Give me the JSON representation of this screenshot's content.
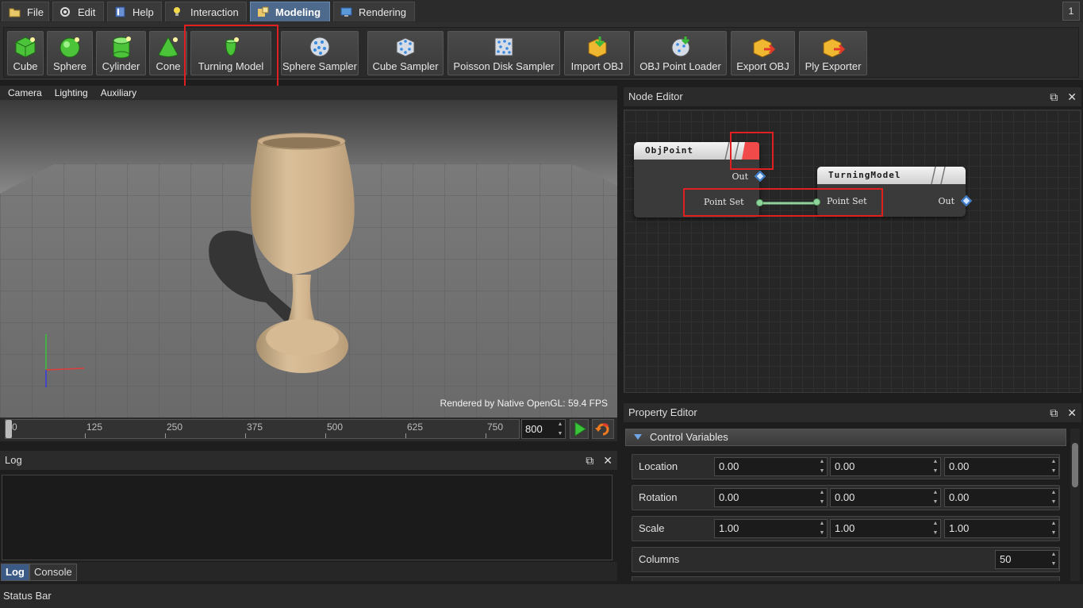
{
  "menu": {
    "tabs": [
      {
        "label": "File"
      },
      {
        "label": "Edit"
      },
      {
        "label": "Help"
      },
      {
        "label": "Interaction"
      },
      {
        "label": "Modeling"
      },
      {
        "label": "Rendering"
      }
    ],
    "corner_label": "1"
  },
  "toolbar": {
    "items": [
      {
        "label": "Cube"
      },
      {
        "label": "Sphere"
      },
      {
        "label": "Cylinder"
      },
      {
        "label": "Cone"
      },
      {
        "label": "Turning Model"
      },
      {
        "label": "Sphere Sampler"
      },
      {
        "label": "Cube Sampler"
      },
      {
        "label": "Poisson Disk Sampler"
      },
      {
        "label": "Import OBJ"
      },
      {
        "label": "OBJ Point Loader"
      },
      {
        "label": "Export OBJ"
      },
      {
        "label": "Ply Exporter"
      }
    ]
  },
  "viewport": {
    "menu": [
      "Camera",
      "Lighting",
      "Auxiliary"
    ],
    "fps_text": "Rendered by Native OpenGL: 59.4 FPS"
  },
  "timeline": {
    "ticks": [
      "0",
      "125",
      "250",
      "375",
      "500",
      "625",
      "750"
    ],
    "frame_value": "800"
  },
  "log": {
    "title": "Log",
    "tabs": [
      {
        "label": "Log"
      },
      {
        "label": "Console"
      }
    ]
  },
  "node_editor": {
    "title": "Node Editor",
    "nodes": [
      {
        "title": "ObjPoint",
        "out_label": "Out",
        "in_label": "Point Set"
      },
      {
        "title": "TurningModel",
        "out_label": "Out",
        "in_label": "Point Set"
      }
    ]
  },
  "property_editor": {
    "title": "Property Editor",
    "section": "Control Variables",
    "rows": [
      {
        "label": "Location",
        "values": [
          "0.00",
          "0.00",
          "0.00"
        ]
      },
      {
        "label": "Rotation",
        "values": [
          "0.00",
          "0.00",
          "0.00"
        ]
      },
      {
        "label": "Scale",
        "values": [
          "1.00",
          "1.00",
          "1.00"
        ]
      },
      {
        "label": "Columns",
        "values": [
          "50"
        ]
      }
    ]
  },
  "status_bar": "Status Bar",
  "colors": {
    "accent_tab": "#4d6a8c",
    "highlight": "#e02020",
    "node_link": "#8fd49a",
    "port_diamond": "#3a78c8",
    "model": "#d1b48e"
  }
}
